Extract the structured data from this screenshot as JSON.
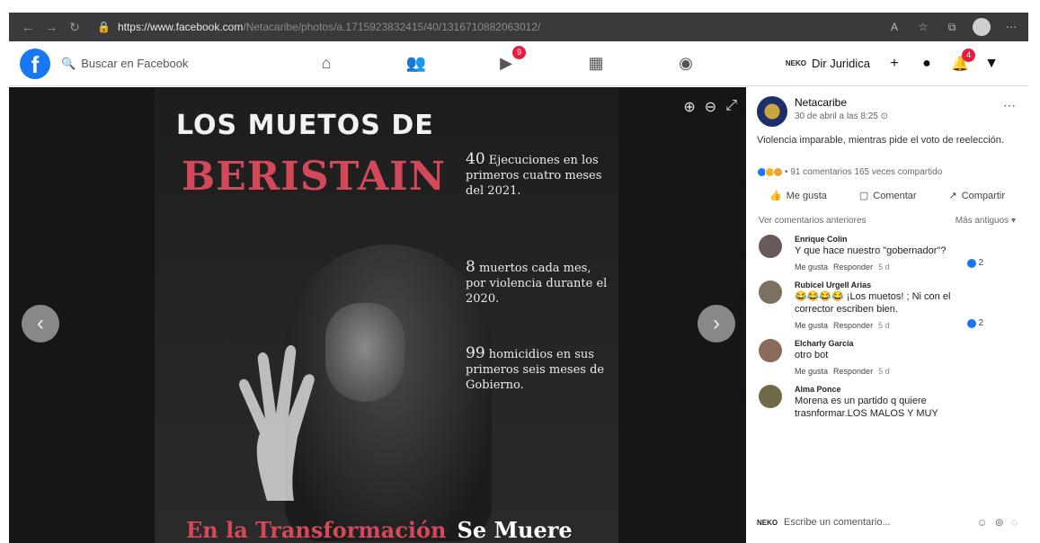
{
  "browser": {
    "url_host": "https://www.facebook.com",
    "url_path": "/Netacaribe/photos/a.1715923832415/40/1316710882063012/"
  },
  "fb": {
    "search_placeholder": "Buscar en Facebook",
    "video_badge": "9",
    "notif_badge": "4",
    "account_mini": "NEKO",
    "account_name": "Dir Juridica"
  },
  "poster": {
    "title_line1": "LOS MUETOS DE",
    "title_line2": "BERISTAIN",
    "stat1_num": "40",
    "stat1_text": "Ejecuciones en los primeros cuatro meses del 2021.",
    "stat2_num": "8",
    "stat2_text": "muertos cada mes, por violencia durante el 2020.",
    "stat3_num": "99",
    "stat3_text": "homicidios en sus primeros seis meses de Gobierno.",
    "bottom_red": "En la Transformación",
    "bottom_white": "Se Muere"
  },
  "post": {
    "page_name": "Netacaribe",
    "date": "30 de abril a las 8:25",
    "caption": "Violencia imparable, mientras pide el voto de reelección.",
    "stats": "• 91 comentarios 165 veces compartido",
    "like_label": "Me gusta",
    "comment_label": "Comentar",
    "share_label": "Compartir",
    "prev_comments": "Ver comentarios anteriores",
    "sort_label": "Más antiguos"
  },
  "comments": [
    {
      "name": "Enrique Colin",
      "text": "Y que hace nuestro \"gobernador\"?",
      "like": "Me gusta",
      "reply": "Responder",
      "time": "5 d",
      "reactions": "2"
    },
    {
      "name": "Rubicel Urgell Arias",
      "text": "😂😂😂😂 ¡Los muetos! ; Ni con el corrector escriben bien.",
      "like": "Me gusta",
      "reply": "Responder",
      "time": "5 d",
      "reactions": "2"
    },
    {
      "name": "Elcharly Garcia",
      "text": "otro bot",
      "like": "Me gusta",
      "reply": "Responder",
      "time": "5 d",
      "reactions": ""
    },
    {
      "name": "Alma Ponce",
      "text": "Morena es un partido q quiere trasnformar.LOS MALOS Y MUY",
      "like": "",
      "reply": "",
      "time": "",
      "reactions": ""
    }
  ],
  "composer": {
    "mini": "NEKO",
    "placeholder": "Escribe un comentario..."
  }
}
